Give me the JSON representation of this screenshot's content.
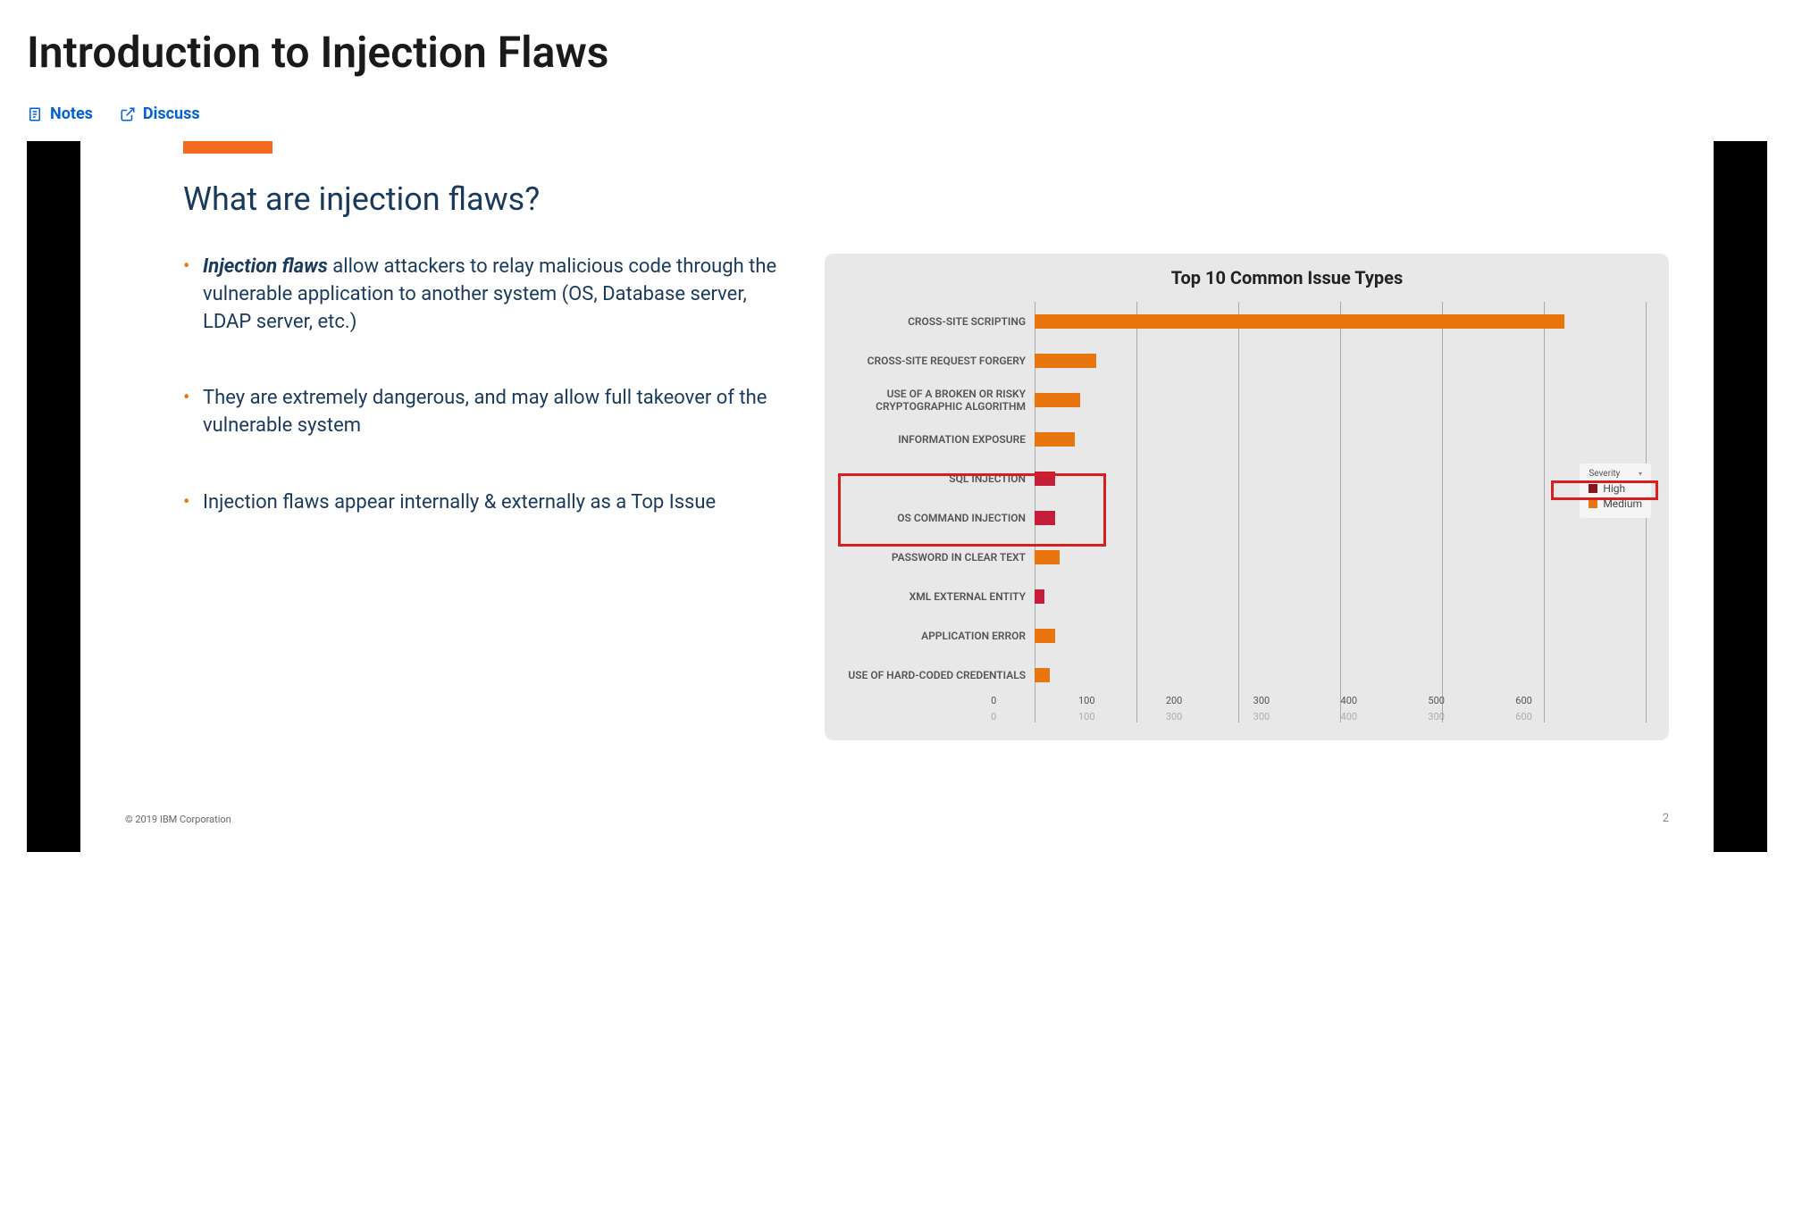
{
  "page": {
    "title": "Introduction to Injection Flaws"
  },
  "actions": {
    "notes": "Notes",
    "discuss": "Discuss"
  },
  "slide": {
    "title": "What are injection flaws?",
    "bullets": [
      {
        "text_prefix_bold": "Injection flaws",
        "text_rest": " allow attackers to relay malicious code through the vulnerable application to another system (OS, Database server, LDAP server, etc.)"
      },
      {
        "text": "They are extremely dangerous, and may allow full takeover of the vulnerable system"
      },
      {
        "text": "Injection flaws appear internally & externally as a Top Issue"
      }
    ],
    "copyright": "© 2019 IBM Corporation",
    "slide_number": "2"
  },
  "chart_data": {
    "type": "bar",
    "orientation": "horizontal",
    "title": "Top 10 Common Issue Types",
    "xlabel": "",
    "ylabel": "",
    "xlim": [
      0,
      600
    ],
    "ticks": [
      0,
      100,
      200,
      300,
      400,
      500,
      600
    ],
    "ticks_duplicate": [
      0,
      100,
      300,
      300,
      400,
      300,
      600
    ],
    "categories": [
      "CROSS-SITE SCRIPTING",
      "CROSS-SITE REQUEST FORGERY",
      "USE OF A BROKEN OR RISKY CRYPTOGRAPHIC ALGORITHM",
      "INFORMATION EXPOSURE",
      "SQL INJECTION",
      "OS COMMAND INJECTION",
      "PASSWORD IN CLEAR TEXT",
      "XML EXTERNAL ENTITY",
      "APPLICATION ERROR",
      "USE OF HARD-CODED CREDENTIALS"
    ],
    "series": [
      {
        "name": "High",
        "color": "#c41e3a",
        "values": [
          0,
          0,
          0,
          0,
          20,
          20,
          0,
          10,
          0,
          0
        ]
      },
      {
        "name": "Medium",
        "color": "#e8750d",
        "values": [
          520,
          60,
          45,
          40,
          0,
          0,
          25,
          0,
          20,
          15
        ]
      }
    ],
    "legend": {
      "title": "Severity",
      "items": [
        {
          "label": "High",
          "color": "#861522"
        },
        {
          "label": "Medium",
          "color": "#e8750d"
        }
      ]
    },
    "highlighted_categories": [
      "SQL INJECTION",
      "OS COMMAND INJECTION"
    ],
    "highlighted_legend": "High"
  }
}
